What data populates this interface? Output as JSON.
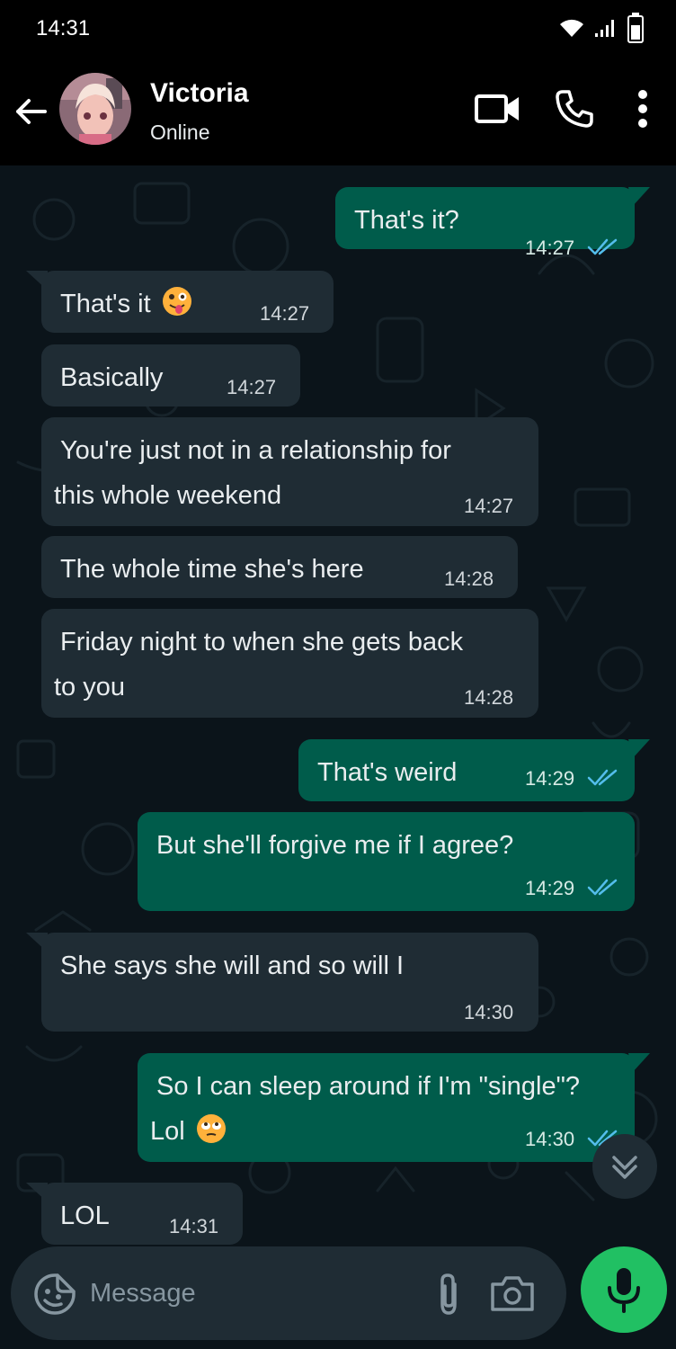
{
  "status_bar": {
    "time": "14:31"
  },
  "header": {
    "name": "Victoria",
    "status": "Online"
  },
  "messages": [
    {
      "dir": "out",
      "text": "That's it?",
      "time": "14:27"
    },
    {
      "dir": "in",
      "text": "That's it",
      "time": "14:27",
      "emoji": "zany-face-emoji"
    },
    {
      "dir": "in",
      "text": "Basically",
      "time": "14:27"
    },
    {
      "dir": "in",
      "line1": "You're just not in a relationship for",
      "line2": "this whole weekend",
      "time": "14:27"
    },
    {
      "dir": "in",
      "text": "The whole time she's here",
      "time": "14:28"
    },
    {
      "dir": "in",
      "line1": "Friday night to when she gets back",
      "line2": "to you",
      "time": "14:28"
    },
    {
      "dir": "out",
      "text": "That's weird",
      "time": "14:29"
    },
    {
      "dir": "out",
      "text": "But she'll forgive me if I agree?",
      "time": "14:29"
    },
    {
      "dir": "in",
      "text": "She says she will and so will I",
      "time": "14:30"
    },
    {
      "dir": "out",
      "line1": "So I can sleep around if I'm \"single\"?",
      "line2": "Lol",
      "time": "14:30",
      "emoji": "eye-roll-emoji"
    },
    {
      "dir": "in",
      "text": "LOL",
      "time": "14:31"
    }
  ],
  "composer": {
    "placeholder": "Message"
  },
  "colors": {
    "incoming": "#1f2c34",
    "outgoing": "#005c4b",
    "read_ticks": "#53bdeb",
    "mic": "#21c063",
    "background": "#0b141a"
  }
}
